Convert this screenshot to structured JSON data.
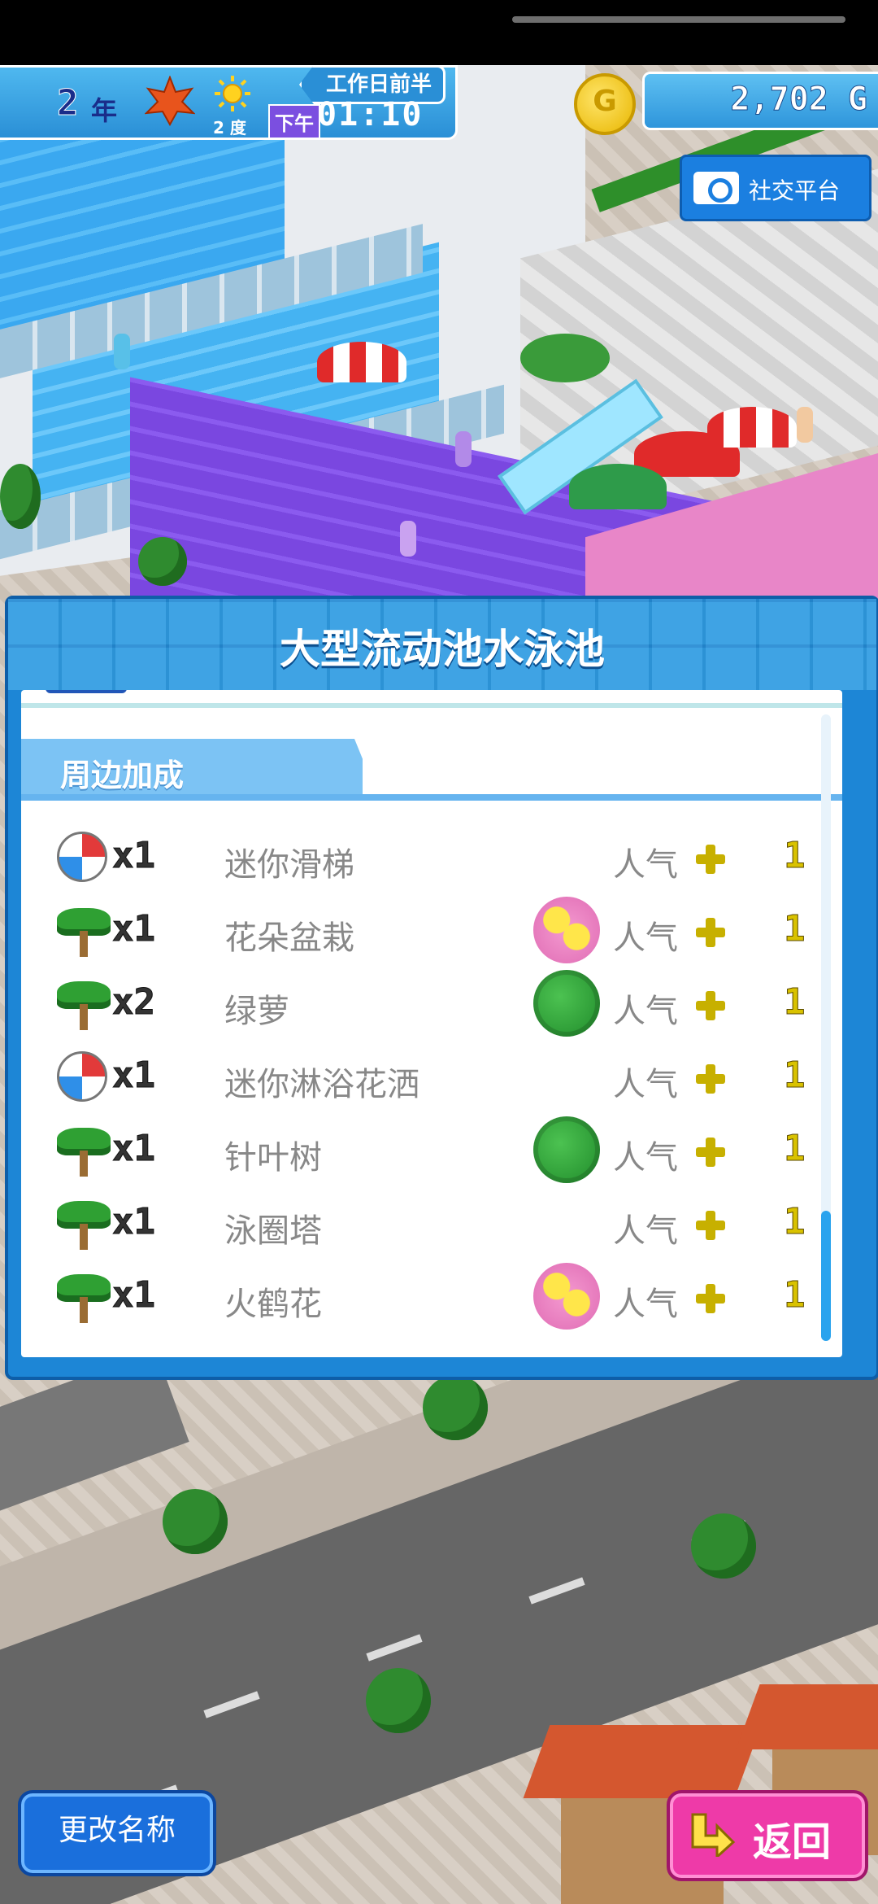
{
  "hud": {
    "year_num": "2",
    "year_unit": "年",
    "temperature": "2 度",
    "period": "工作日前半",
    "ampm": "下午",
    "time": "01:10",
    "money": "2,702 G",
    "coin_letter": "G"
  },
  "social": {
    "label": "社交平台"
  },
  "panel": {
    "title": "大型流动池水泳池",
    "section_title": "周边加成",
    "rows": [
      {
        "icon": "beach-ball-icon",
        "qty": "x1",
        "name": "迷你滑梯",
        "bonus_icon": "",
        "stat": "人气",
        "value": "1"
      },
      {
        "icon": "palm-tree-icon",
        "qty": "x1",
        "name": "花朵盆栽",
        "bonus_icon": "flower-bonus-icon",
        "stat": "人气",
        "value": "1"
      },
      {
        "icon": "palm-tree-icon",
        "qty": "x2",
        "name": "绿萝",
        "bonus_icon": "leaf-bonus-icon",
        "stat": "人气",
        "value": "1"
      },
      {
        "icon": "beach-ball-icon",
        "qty": "x1",
        "name": "迷你淋浴花洒",
        "bonus_icon": "",
        "stat": "人气",
        "value": "1"
      },
      {
        "icon": "palm-tree-icon",
        "qty": "x1",
        "name": "针叶树",
        "bonus_icon": "leaf-bonus-icon",
        "stat": "人气",
        "value": "1"
      },
      {
        "icon": "palm-tree-icon",
        "qty": "x1",
        "name": "泳圈塔",
        "bonus_icon": "",
        "stat": "人气",
        "value": "1"
      },
      {
        "icon": "palm-tree-icon",
        "qty": "x1",
        "name": "火鹤花",
        "bonus_icon": "flower-bonus-icon",
        "stat": "人气",
        "value": "1"
      }
    ]
  },
  "buttons": {
    "rename": "更改名称",
    "back": "返回"
  },
  "colors": {
    "panel_blue": "#1d86d6",
    "back_pink": "#ee3aa8",
    "rename_blue": "#1a6fdc",
    "stat_gold": "#d9c200"
  }
}
